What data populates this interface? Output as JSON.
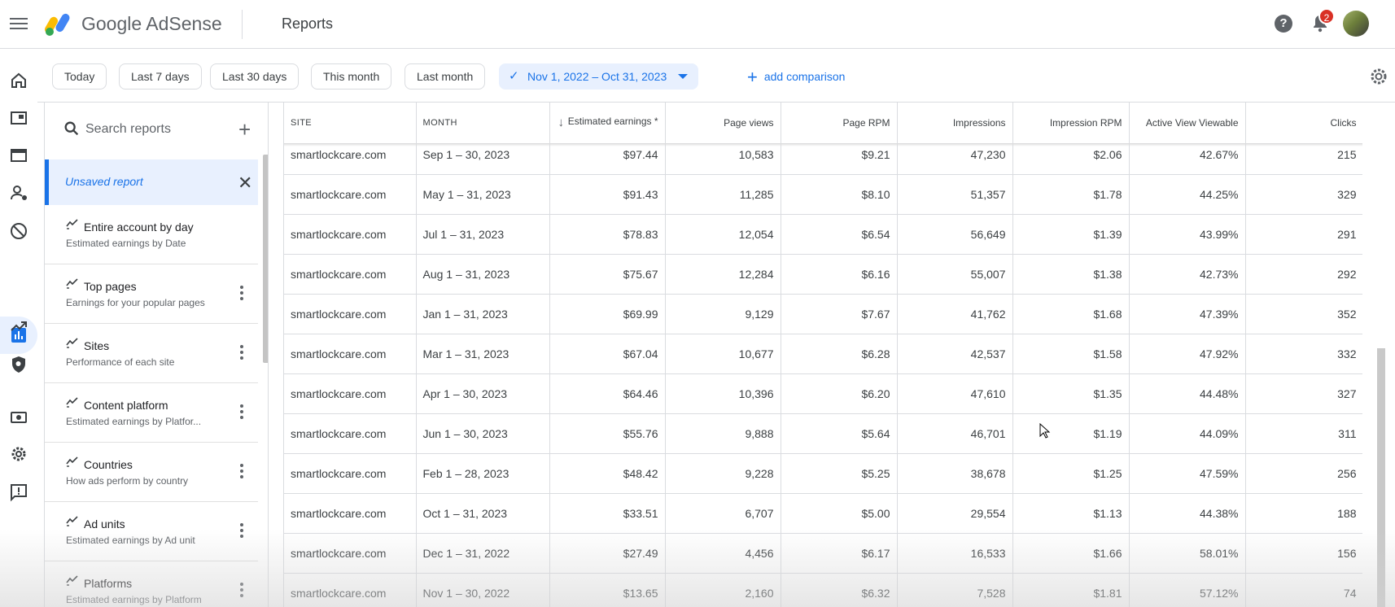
{
  "header": {
    "brand": "Google AdSense",
    "page_title": "Reports",
    "notification_count": "2",
    "help_glyph": "?"
  },
  "rail": {
    "items": [
      "home-icon",
      "ads-icon",
      "sites-icon",
      "account-people-icon",
      "blocking-icon",
      "reports-icon",
      "optimization-icon",
      "privacy-icon",
      "payments-icon",
      "settings-icon",
      "feedback-icon"
    ],
    "active": "reports-icon"
  },
  "filters": {
    "chips": [
      "Today",
      "Last 7 days",
      "Last 30 days",
      "This month",
      "Last month"
    ],
    "selected_range": "Nov 1, 2022 – Oct 31, 2023",
    "add_comparison": "add comparison"
  },
  "reports_panel": {
    "search_placeholder": "Search reports",
    "unsaved_label": "Unsaved report",
    "items": [
      {
        "title": "Entire account by day",
        "subtitle": "Estimated earnings by Date"
      },
      {
        "title": "Top pages",
        "subtitle": "Earnings for your popular pages"
      },
      {
        "title": "Sites",
        "subtitle": "Performance of each site"
      },
      {
        "title": "Content platform",
        "subtitle": "Estimated earnings by Platfor..."
      },
      {
        "title": "Countries",
        "subtitle": "How ads perform by country"
      },
      {
        "title": "Ad units",
        "subtitle": "Estimated earnings by Ad unit"
      },
      {
        "title": "Platforms",
        "subtitle": "Estimated earnings by Platform"
      }
    ]
  },
  "table": {
    "columns": [
      "Site",
      "Month",
      "Estimated earnings *",
      "Page views",
      "Page RPM",
      "Impressions",
      "Impression RPM",
      "Active View Viewable",
      "Clicks"
    ],
    "rows": [
      [
        "smartlockcare.com",
        "Sep 1 – 30, 2023",
        "$97.44",
        "10,583",
        "$9.21",
        "47,230",
        "$2.06",
        "42.67%",
        "215"
      ],
      [
        "smartlockcare.com",
        "May 1 – 31, 2023",
        "$91.43",
        "11,285",
        "$8.10",
        "51,357",
        "$1.78",
        "44.25%",
        "329"
      ],
      [
        "smartlockcare.com",
        "Jul 1 – 31, 2023",
        "$78.83",
        "12,054",
        "$6.54",
        "56,649",
        "$1.39",
        "43.99%",
        "291"
      ],
      [
        "smartlockcare.com",
        "Aug 1 – 31, 2023",
        "$75.67",
        "12,284",
        "$6.16",
        "55,007",
        "$1.38",
        "42.73%",
        "292"
      ],
      [
        "smartlockcare.com",
        "Jan 1 – 31, 2023",
        "$69.99",
        "9,129",
        "$7.67",
        "41,762",
        "$1.68",
        "47.39%",
        "352"
      ],
      [
        "smartlockcare.com",
        "Mar 1 – 31, 2023",
        "$67.04",
        "10,677",
        "$6.28",
        "42,537",
        "$1.58",
        "47.92%",
        "332"
      ],
      [
        "smartlockcare.com",
        "Apr 1 – 30, 2023",
        "$64.46",
        "10,396",
        "$6.20",
        "47,610",
        "$1.35",
        "44.48%",
        "327"
      ],
      [
        "smartlockcare.com",
        "Jun 1 – 30, 2023",
        "$55.76",
        "9,888",
        "$5.64",
        "46,701",
        "$1.19",
        "44.09%",
        "311"
      ],
      [
        "smartlockcare.com",
        "Feb 1 – 28, 2023",
        "$48.42",
        "9,228",
        "$5.25",
        "38,678",
        "$1.25",
        "47.59%",
        "256"
      ],
      [
        "smartlockcare.com",
        "Oct 1 – 31, 2023",
        "$33.51",
        "6,707",
        "$5.00",
        "29,554",
        "$1.13",
        "44.38%",
        "188"
      ],
      [
        "smartlockcare.com",
        "Dec 1 – 31, 2022",
        "$27.49",
        "4,456",
        "$6.17",
        "16,533",
        "$1.66",
        "58.01%",
        "156"
      ],
      [
        "smartlockcare.com",
        "Nov 1 – 30, 2022",
        "$13.65",
        "2,160",
        "$6.32",
        "7,528",
        "$1.81",
        "57.12%",
        "74"
      ]
    ]
  },
  "colors": {
    "accent": "#1a73e8",
    "selected_bg": "#e8f0fe",
    "badge": "#d93025"
  }
}
